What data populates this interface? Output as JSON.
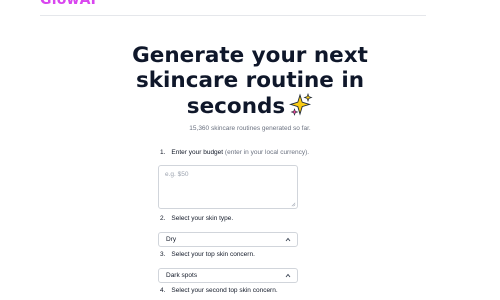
{
  "brand": {
    "logo_text": "GlowAI"
  },
  "hero": {
    "title_line1": "Generate your next",
    "title_line2": "skincare routine in",
    "title_line3": "seconds",
    "sparkle_icon": "sparkles-icon",
    "counter": "15,360 skincare routines generated so far."
  },
  "form": {
    "step1": {
      "number": "1.",
      "label": "Enter your budget",
      "hint": "(enter in your local currency)."
    },
    "budget_input": {
      "placeholder": "e.g. $50",
      "value": ""
    },
    "step2": {
      "number": "2.",
      "label": "Select your skin type."
    },
    "skin_type": {
      "selected": "Dry"
    },
    "step3": {
      "number": "3.",
      "label": "Select your top skin concern."
    },
    "top_concern": {
      "selected": "Dark spots"
    },
    "step4": {
      "number": "4.",
      "label": "Select your second top skin concern."
    }
  },
  "colors": {
    "brand": "#d946ef",
    "title": "#0f172a",
    "muted": "#6b7280",
    "sparkle_yellow": "#facc15",
    "sparkle_pink": "#ec4899"
  }
}
